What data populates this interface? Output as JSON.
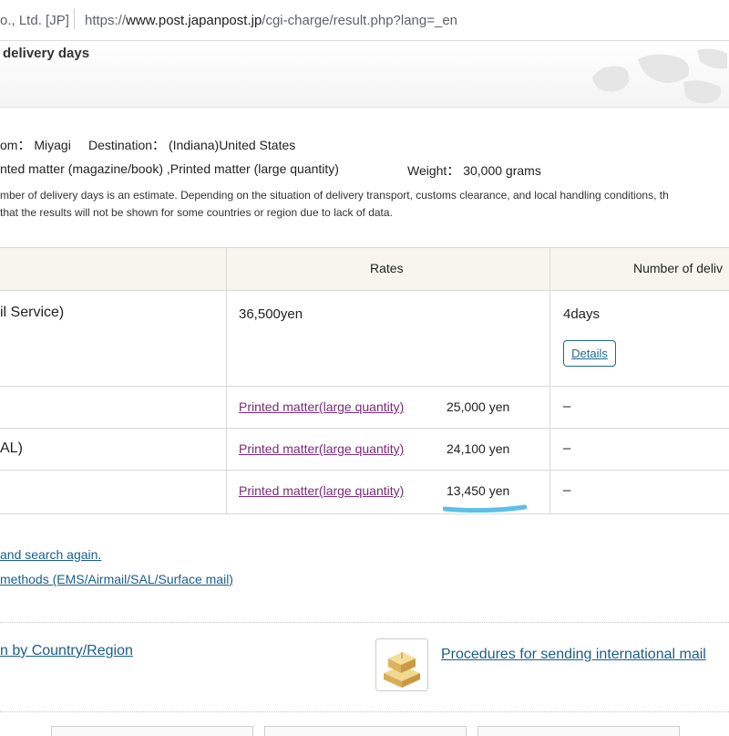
{
  "browser": {
    "site_label": "o., Ltd. [JP]",
    "url_prefix": "https://",
    "url_host": "www.post.japanpost.jp",
    "url_path": "/cgi-charge/result.php?lang=_en"
  },
  "header": {
    "title": "delivery days"
  },
  "conditions": {
    "from_label": "om：",
    "from_value": "Miyagi",
    "dest_label": "Destination：",
    "dest_value": "(Indiana)United States",
    "item": "nted matter (magazine/book) ,Printed matter (large quantity)",
    "weight_label": "Weight：",
    "weight_value": "30,000 grams"
  },
  "notice": {
    "line1": "mber of delivery days is an estimate. Depending on the situation of delivery transport, customs clearance, and local handling conditions, th",
    "line2": "that the results will not be shown for some countries or region due to lack of data."
  },
  "table": {
    "headers": {
      "rates": "Rates",
      "days": "Number of deliv"
    },
    "rows": [
      {
        "method": "il Service)",
        "rate": "36,500yen",
        "days": "4days",
        "details_label": "Details"
      },
      {
        "method": "",
        "link": "Printed matter(large quantity)",
        "rate": "25,000 yen",
        "days": "–"
      },
      {
        "method": "AL)",
        "link": "Printed matter(large quantity)",
        "rate": "24,100 yen",
        "days": "–"
      },
      {
        "method": "",
        "link": "Printed matter(large quantity)",
        "rate": "13,450 yen",
        "days": "–"
      }
    ],
    "highlight_color": "#5bc0e8"
  },
  "links": {
    "search_again": "and search again.",
    "methods": "methods (EMS/Airmail/SAL/Surface mail)",
    "by_country": "n by Country/Region",
    "procedures": "Procedures for sending international mail"
  },
  "colors": {
    "link": "#1a5e8c",
    "visited_link": "#7a2a7a",
    "header_bg": "#f7f5ee",
    "details_border": "#1d6a8f"
  },
  "icons": {
    "box": "cardboard-boxes-icon",
    "map": "world-map-icon"
  }
}
